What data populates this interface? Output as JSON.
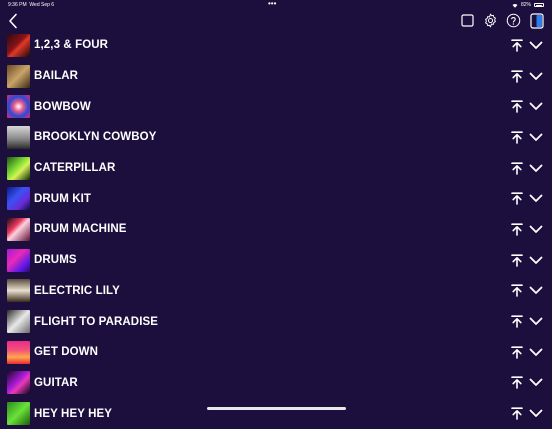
{
  "status_bar": {
    "time": "9:36 PM",
    "date": "Wed Sep 6",
    "dots": "•••",
    "battery_percent": "82%",
    "battery_level": 0.82
  },
  "header": {
    "back_icon": "chevron-left-icon",
    "icons": [
      "square-icon",
      "gear-icon",
      "help-circle-icon",
      "sidebar-toggle-icon"
    ]
  },
  "colors": {
    "background": "#1d0f3d",
    "text": "#ffffff",
    "accent_blue": "#2f7de8"
  },
  "list": {
    "items": [
      {
        "label": "1,2,3 & FOUR",
        "thumb": "linear-gradient(135deg,#2a0a12 0%,#8a1418 45%,#e23a28 55%,#1a0508 100%)"
      },
      {
        "label": "BAILAR",
        "thumb": "linear-gradient(135deg,#6a4a24 0%,#c9a46a 50%,#3a2612 100%)"
      },
      {
        "label": "BOWBOW",
        "thumb": "radial-gradient(circle at 50% 50%,#ffffff 0%,#e85a8a 30%,#2a4ad8 60%,#e8286a 100%)"
      },
      {
        "label": "BROOKLYN COWBOY",
        "thumb": "linear-gradient(180deg,#d8d8d8 0%,#8a8a8a 55%,#2a2a2a 100%)"
      },
      {
        "label": "CATERPILLAR",
        "thumb": "linear-gradient(135deg,#1a5a12 0%,#8ae23a 45%,#d8f25a 60%,#0a2a08 100%)"
      },
      {
        "label": "DRUM KIT",
        "thumb": "linear-gradient(135deg,#0a1a8a 0%,#3a52f2 40%,#6a2ad8 70%,#08103a 100%)"
      },
      {
        "label": "DRUM MACHINE",
        "thumb": "linear-gradient(135deg,#1a0a1a 0%,#e8385a 35%,#ffd0e0 50%,#5a1030 100%)"
      },
      {
        "label": "DRUMS",
        "thumb": "linear-gradient(135deg,#a818d8 0%,#e82ab8 40%,#5a18e8 75%,#2a0a5a 100%)"
      },
      {
        "label": "ELECTRIC LILY",
        "thumb": "linear-gradient(180deg,#5a4a3a 0%,#e8e0d0 50%,#3a2a1a 100%)"
      },
      {
        "label": "FLIGHT TO PARADISE",
        "thumb": "linear-gradient(135deg,#2a2a2a 0%,#e8e8e8 50%,#6a6a6a 100%)"
      },
      {
        "label": "GET DOWN",
        "thumb": "linear-gradient(180deg,#e82a8a 0%,#f2527a 40%,#ffa84a 70%,#e8283a 100%)"
      },
      {
        "label": "GUITAR",
        "thumb": "linear-gradient(135deg,#18082a 0%,#a81ad8 45%,#e83ab8 60%,#0a0418 100%)"
      },
      {
        "label": "HEY HEY HEY",
        "thumb": "linear-gradient(135deg,#2a8a1a 0%,#6ae23a 50%,#1a5a0a 100%)"
      }
    ],
    "action_icons": [
      "move-to-top-icon",
      "chevron-down-icon"
    ]
  }
}
